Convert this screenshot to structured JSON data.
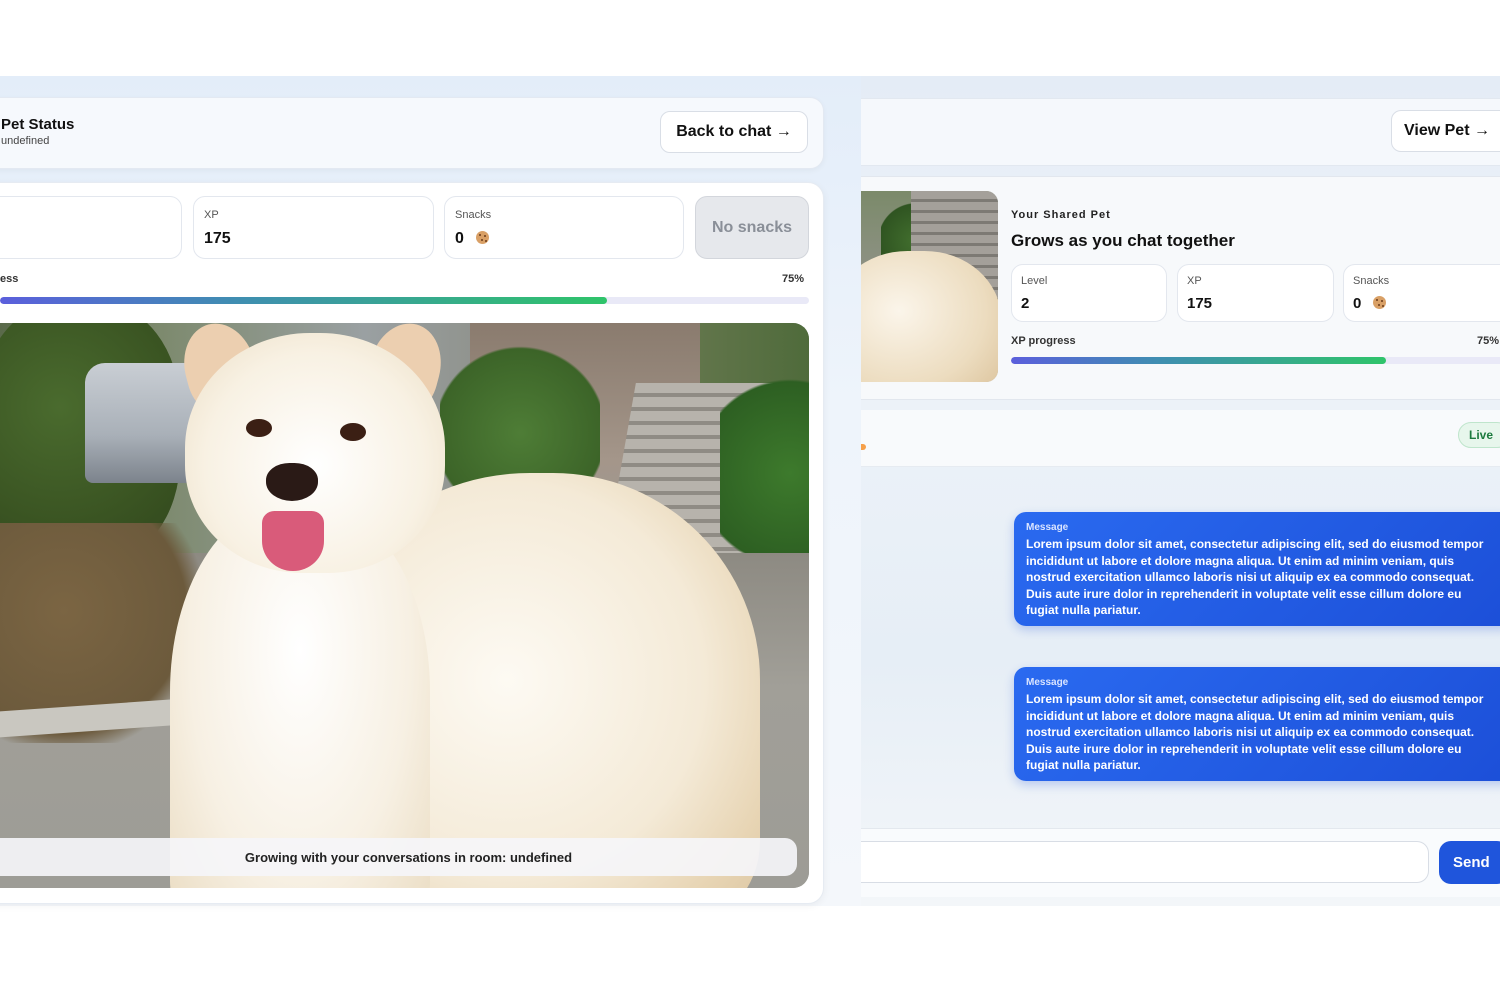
{
  "left_panel": {
    "title": "Pet Status",
    "subtitle": "undefined",
    "back_button": "Back to chat →",
    "stats": [
      {
        "label": "XP",
        "value": "175"
      },
      {
        "label": "Snacks",
        "value": "0"
      }
    ],
    "no_snacks_button": "No snacks",
    "progress_label": "ess",
    "progress_percent": "75%",
    "progress_fraction": 0.75,
    "image_caption": "Growing with your conversations in room: undefined"
  },
  "right_panel": {
    "view_pet_button": "View Pet →",
    "shared_label": "Your Shared Pet",
    "shared_title": "Grows as you chat together",
    "stats": [
      {
        "label": "Level",
        "value": "2"
      },
      {
        "label": "XP",
        "value": "175"
      },
      {
        "label": "Snacks",
        "value": "0"
      }
    ],
    "progress_label": "XP progress",
    "progress_percent": "75%",
    "progress_fraction": 0.75,
    "live_badge": "Live",
    "messages": [
      {
        "title": "Message",
        "text": "Lorem ipsum dolor sit amet, consectetur adipiscing elit, sed do eiusmod tempor incididunt ut labore et dolore magna aliqua. Ut enim ad minim veniam, quis nostrud exercitation ullamco laboris nisi ut aliquip ex ea commodo consequat. Duis aute irure dolor in reprehenderit in voluptate velit esse cillum dolore eu fugiat nulla pariatur."
      },
      {
        "title": "Message",
        "text": "Lorem ipsum dolor sit amet, consectetur adipiscing elit, sed do eiusmod tempor incididunt ut labore et dolore magna aliqua. Ut enim ad minim veniam, quis nostrud exercitation ullamco laboris nisi ut aliquip ex ea commodo consequat. Duis aute irure dolor in reprehenderit in voluptate velit esse cillum dolore eu fugiat nulla pariatur."
      }
    ],
    "chat_input_value": "",
    "send_button": "Send"
  },
  "icons": {
    "snack": "cookie-icon",
    "arrow": "right-arrow"
  },
  "colors": {
    "accent_blue": "#1f55dc",
    "progress_start": "#5b5fdc",
    "progress_end": "#2fc46a",
    "live_green": "#1c7a3e"
  }
}
